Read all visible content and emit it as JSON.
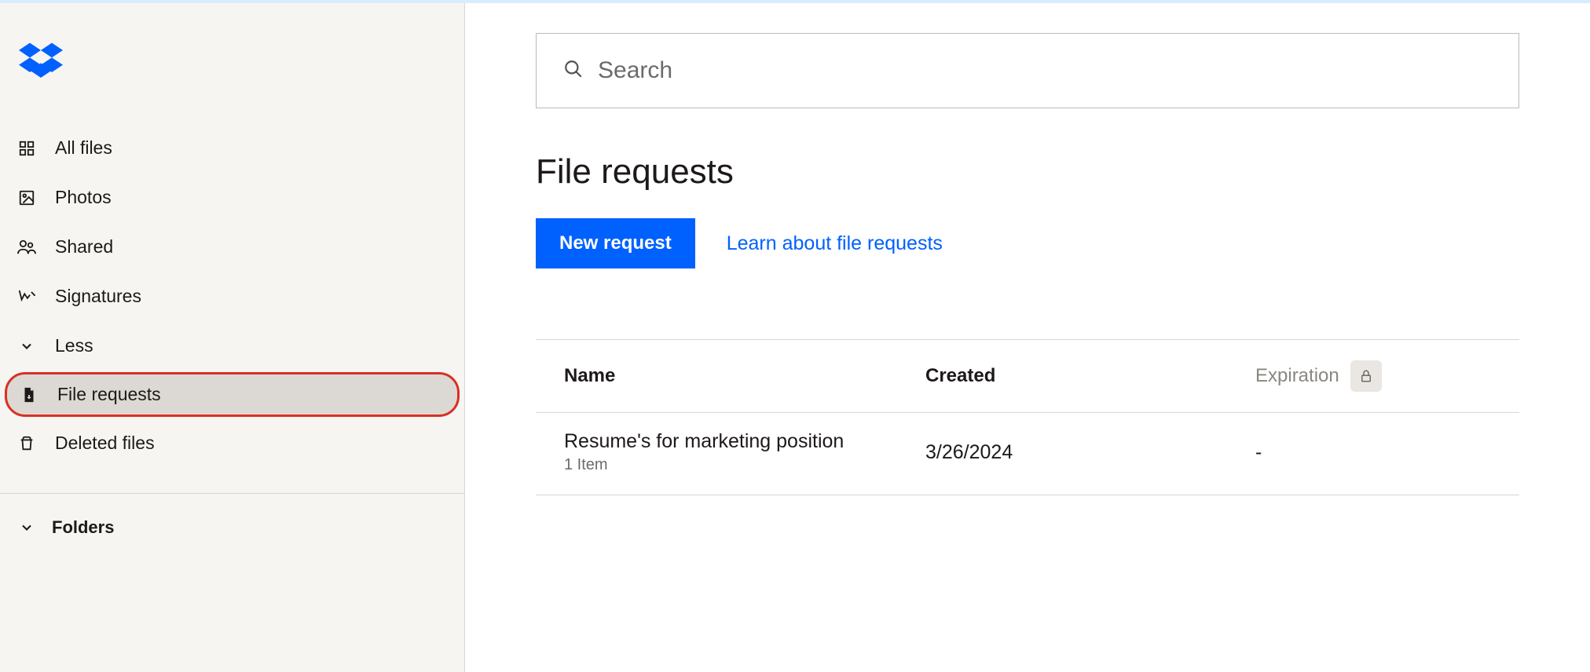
{
  "search": {
    "placeholder": "Search"
  },
  "sidebar": {
    "items": [
      {
        "label": "All files"
      },
      {
        "label": "Photos"
      },
      {
        "label": "Shared"
      },
      {
        "label": "Signatures"
      },
      {
        "label": "Less"
      },
      {
        "label": "File requests"
      },
      {
        "label": "Deleted files"
      }
    ],
    "folders_label": "Folders"
  },
  "page": {
    "title": "File requests",
    "new_request_label": "New request",
    "learn_link_label": "Learn about file requests"
  },
  "table": {
    "headers": {
      "name": "Name",
      "created": "Created",
      "expiration": "Expiration"
    },
    "rows": [
      {
        "name": "Resume's for marketing position",
        "subtitle": "1 Item",
        "created": "3/26/2024",
        "expiration": "-"
      }
    ]
  }
}
